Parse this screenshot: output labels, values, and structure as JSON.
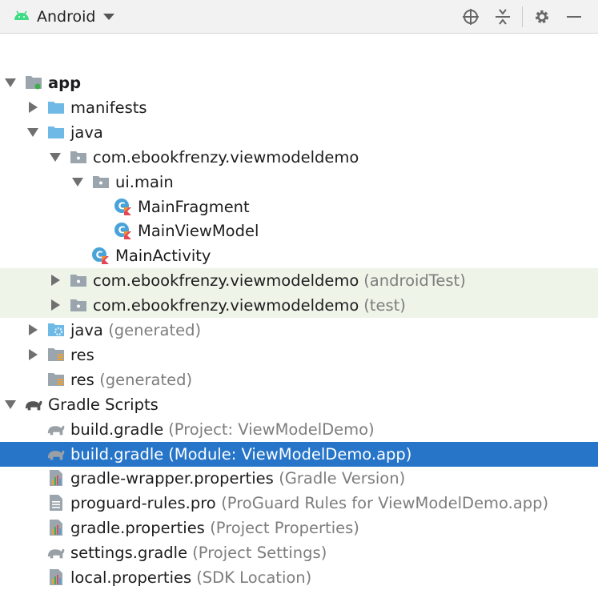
{
  "toolbar": {
    "title": "Android",
    "buttons": [
      "locate-icon",
      "collapse-all-icon",
      "gear-icon",
      "minimize-icon"
    ]
  },
  "tree": [
    {
      "name": "app",
      "suffix": "",
      "depth": 0,
      "arrow": "down",
      "icon": "module-icon",
      "bold": true
    },
    {
      "name": "manifests",
      "suffix": "",
      "depth": 1,
      "arrow": "right",
      "icon": "folder-icon"
    },
    {
      "name": "java",
      "suffix": "",
      "depth": 1,
      "arrow": "down",
      "icon": "folder-icon"
    },
    {
      "name": "com.ebookfrenzy.viewmodeldemo",
      "suffix": "",
      "depth": 2,
      "arrow": "down",
      "icon": "package-icon"
    },
    {
      "name": "ui.main",
      "suffix": "",
      "depth": 3,
      "arrow": "down",
      "icon": "package-icon"
    },
    {
      "name": "MainFragment",
      "suffix": "",
      "depth": 4,
      "arrow": "",
      "icon": "kotlin-class-icon"
    },
    {
      "name": "MainViewModel",
      "suffix": "",
      "depth": 4,
      "arrow": "",
      "icon": "kotlin-class-icon"
    },
    {
      "name": "MainActivity",
      "suffix": "",
      "depth": 3,
      "arrow": "",
      "icon": "kotlin-class-icon"
    },
    {
      "name": "com.ebookfrenzy.viewmodeldemo",
      "suffix": " (androidTest)",
      "depth": 2,
      "arrow": "right",
      "icon": "package-icon",
      "alt": true
    },
    {
      "name": "com.ebookfrenzy.viewmodeldemo",
      "suffix": " (test)",
      "depth": 2,
      "arrow": "right",
      "icon": "package-icon",
      "alt": true
    },
    {
      "name": "java",
      "suffix": " (generated)",
      "depth": 1,
      "arrow": "right",
      "icon": "generated-folder-icon"
    },
    {
      "name": "res",
      "suffix": "",
      "depth": 1,
      "arrow": "right",
      "icon": "res-folder-icon"
    },
    {
      "name": "res",
      "suffix": " (generated)",
      "depth": 1,
      "arrow": "",
      "icon": "res-folder-icon"
    },
    {
      "name": "Gradle Scripts",
      "suffix": "",
      "depth": 0,
      "arrow": "down",
      "icon": "gradle-icon"
    },
    {
      "name": "build.gradle",
      "suffix": " (Project: ViewModelDemo)",
      "depth": 1,
      "arrow": "",
      "icon": "gradle-file-icon"
    },
    {
      "name": "build.gradle",
      "suffix": " (Module: ViewModelDemo.app)",
      "depth": 1,
      "arrow": "",
      "icon": "gradle-file-icon",
      "selected": true
    },
    {
      "name": "gradle-wrapper.properties",
      "suffix": " (Gradle Version)",
      "depth": 1,
      "arrow": "",
      "icon": "properties-icon"
    },
    {
      "name": "proguard-rules.pro",
      "suffix": " (ProGuard Rules for ViewModelDemo.app)",
      "depth": 1,
      "arrow": "",
      "icon": "text-file-icon"
    },
    {
      "name": "gradle.properties",
      "suffix": " (Project Properties)",
      "depth": 1,
      "arrow": "",
      "icon": "properties-icon"
    },
    {
      "name": "settings.gradle",
      "suffix": " (Project Settings)",
      "depth": 1,
      "arrow": "",
      "icon": "gradle-file-icon"
    },
    {
      "name": "local.properties",
      "suffix": " (SDK Location)",
      "depth": 1,
      "arrow": "",
      "icon": "properties-icon"
    }
  ]
}
